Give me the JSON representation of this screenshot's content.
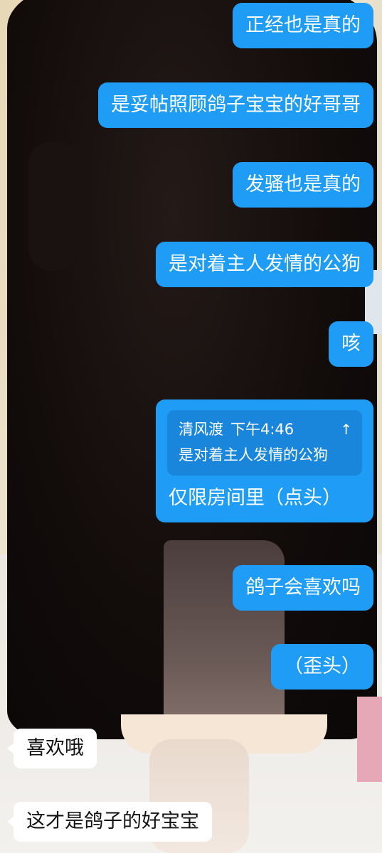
{
  "messages": [
    {
      "text": "正经也是真的"
    },
    {
      "text": "是妥帖照顾鸽子宝宝的好哥哥"
    },
    {
      "text": "发骚也是真的"
    },
    {
      "text": "是对着主人发情的公狗"
    },
    {
      "text": "咳"
    },
    {
      "quote": {
        "sender": "清风渡",
        "time": "下午4:46",
        "arrow": "↑",
        "text": "是对着主人发情的公狗"
      },
      "text": "仅限房间里（点头）"
    },
    {
      "text": "鸽子会喜欢吗"
    },
    {
      "text": "（歪头）"
    },
    {
      "text": "喜欢哦"
    },
    {
      "text": "这才是鸽子的好宝宝"
    }
  ],
  "colors": {
    "outgoing_bubble": "#1e9cf6",
    "quote_background": "#1a86db",
    "incoming_bubble": "#ffffff"
  }
}
